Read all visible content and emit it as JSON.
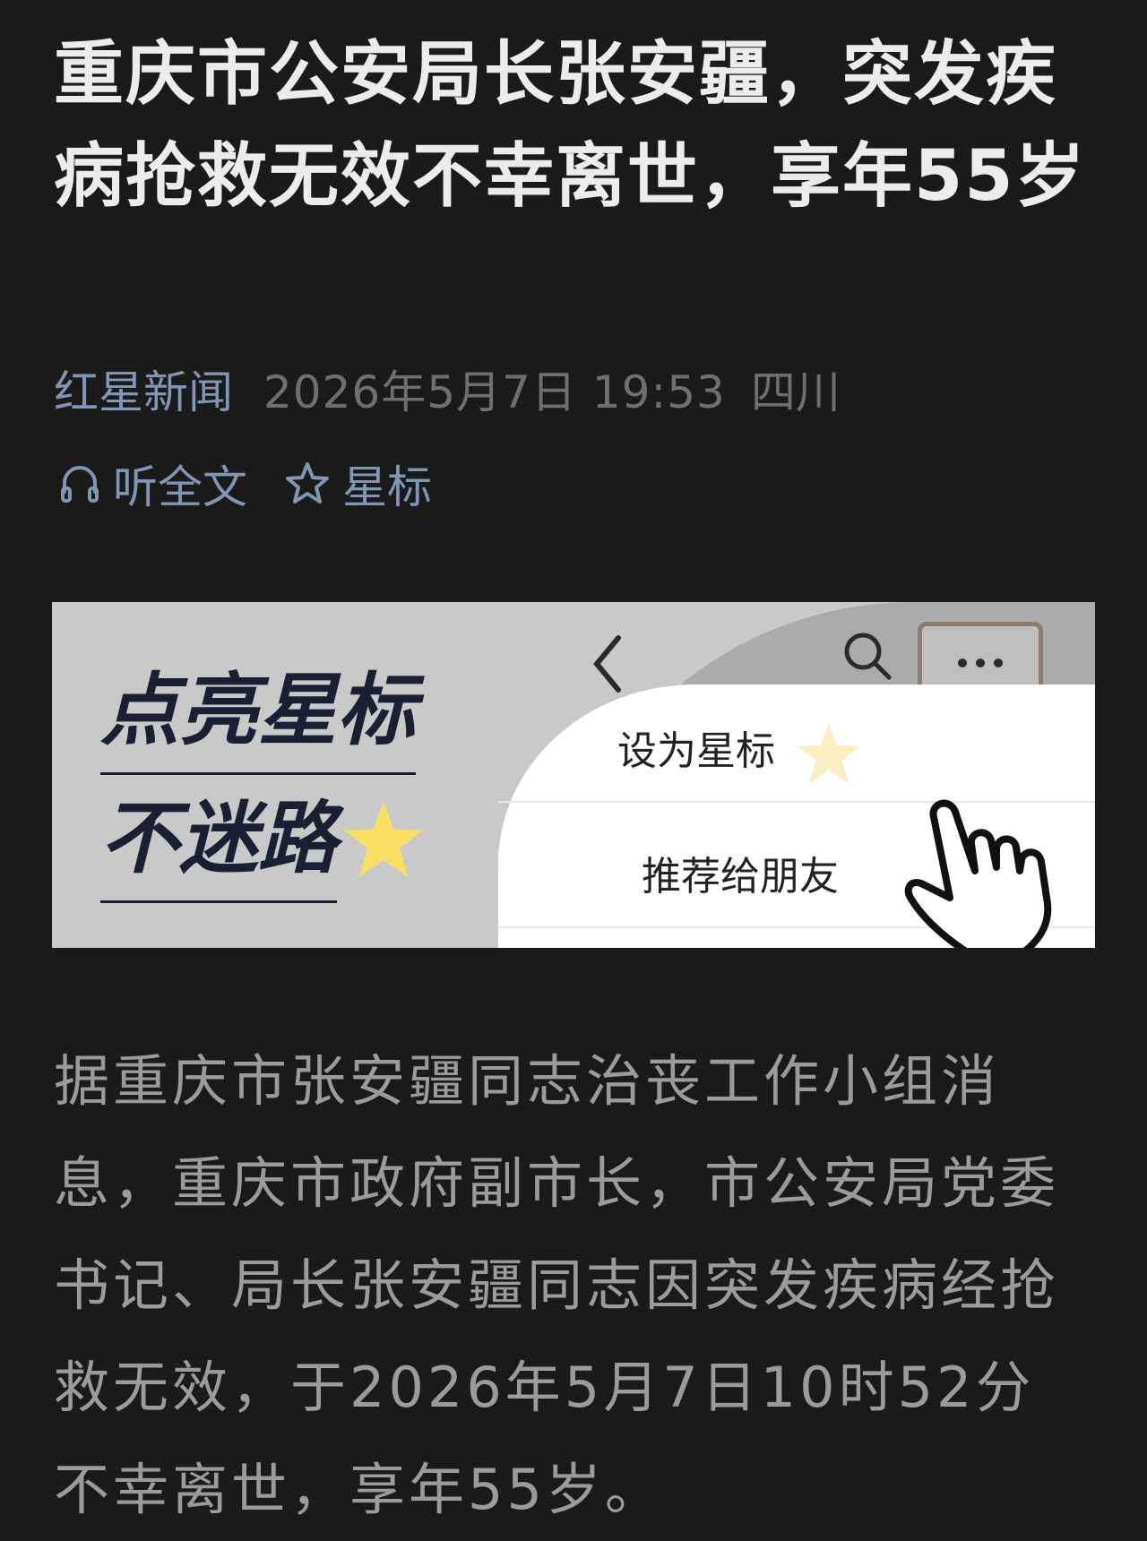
{
  "article": {
    "title": "重庆市公安局长张安疆，突发疾病抢救无效不幸离世，享年55岁",
    "source": "红星新闻",
    "date": "2026年5月7日 19:53",
    "region": "四川",
    "body": "据重庆市张安疆同志治丧工作小组消息，重庆市政府副市长，市公安局党委书记、局长张安疆同志因突发疾病经抢救无效，于2026年5月7日10时52分不幸离世，享年55岁。"
  },
  "actions": {
    "listen_label": "听全文",
    "star_label": "星标"
  },
  "banner": {
    "line1": "点亮星标",
    "line2": "不迷路",
    "menu_item_1": "设为星标",
    "menu_item_2": "推荐给朋友"
  },
  "colors": {
    "background": "#1a1a1a",
    "accent": "#7f96b7",
    "meta_gray": "#6f6f6f",
    "body_gray": "#9b9b9b",
    "star_yellow": "#f7e08a"
  },
  "icons": {
    "listen": "headphones-icon",
    "star": "star-outline-icon",
    "back": "chevron-left-icon",
    "search": "search-icon",
    "more": "more-dots-icon",
    "hand": "pointing-hand-icon"
  }
}
